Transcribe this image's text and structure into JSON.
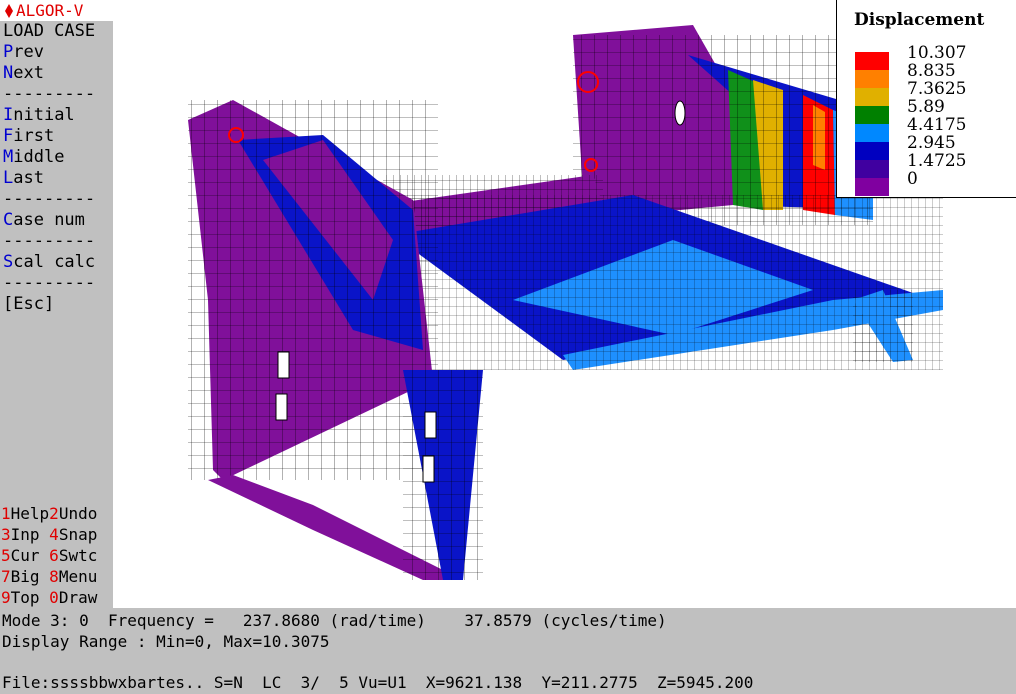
{
  "app": {
    "title": "ALGOR-V"
  },
  "menu": {
    "items": [
      {
        "hot": "",
        "rest": "LOAD CASE"
      },
      {
        "hot": "P",
        "rest": "rev"
      },
      {
        "hot": "N",
        "rest": "ext"
      },
      {
        "hot": "",
        "rest": "---------"
      },
      {
        "hot": "I",
        "rest": "nitial"
      },
      {
        "hot": "F",
        "rest": "irst"
      },
      {
        "hot": "M",
        "rest": "iddle"
      },
      {
        "hot": "L",
        "rest": "ast"
      },
      {
        "hot": "",
        "rest": "---------"
      },
      {
        "hot": "C",
        "rest": "ase num"
      },
      {
        "hot": "",
        "rest": "---------"
      },
      {
        "hot": "S",
        "rest": "cal calc"
      },
      {
        "hot": "",
        "rest": "---------"
      },
      {
        "hot": "",
        "rest": "[Esc]"
      }
    ]
  },
  "function_keys": [
    {
      "n1": "1",
      "l1": "Help",
      "n2": "2",
      "l2": "Undo"
    },
    {
      "n1": "3",
      "l1": "Inp ",
      "n2": "4",
      "l2": "Snap"
    },
    {
      "n1": "5",
      "l1": "Cur ",
      "n2": "6",
      "l2": "Swtc"
    },
    {
      "n1": "7",
      "l1": "Big ",
      "n2": "8",
      "l2": "Menu"
    },
    {
      "n1": "9",
      "l1": "Top ",
      "n2": "0",
      "l2": "Draw"
    }
  ],
  "legend": {
    "title": "Displacement",
    "entries": [
      {
        "label": "10.307",
        "color": "#ff0000"
      },
      {
        "label": "8.835",
        "color": "#ff8000"
      },
      {
        "label": "7.3625",
        "color": "#e0b000"
      },
      {
        "label": "5.89",
        "color": "#008000"
      },
      {
        "label": "4.4175",
        "color": "#0088ff"
      },
      {
        "label": "2.945",
        "color": "#0000c0"
      },
      {
        "label": "1.4725",
        "color": "#4000a0"
      },
      {
        "label": "0",
        "color": "#8000a0"
      }
    ]
  },
  "status": {
    "line1": "Mode 3: 0  Frequency =   237.8680 (rad/time)    37.8579 (cycles/time)",
    "line2": "Display Range : Min=0, Max=10.3075",
    "line3": "File:ssssbbwxbartes.. S=N  LC  3/  5 Vu=U1  X=9621.138  Y=211.2775  Z=5945.200"
  },
  "colors": {
    "purple": "#80109a",
    "blue": "#0a14c8",
    "light_blue": "#1e90ff",
    "green": "#10901a",
    "yellow": "#e0b000",
    "orange": "#ff8000",
    "red": "#ff0000",
    "panel_gray": "#c0c0c0"
  },
  "icons": {
    "title_icon": "red-diamond-icon"
  }
}
